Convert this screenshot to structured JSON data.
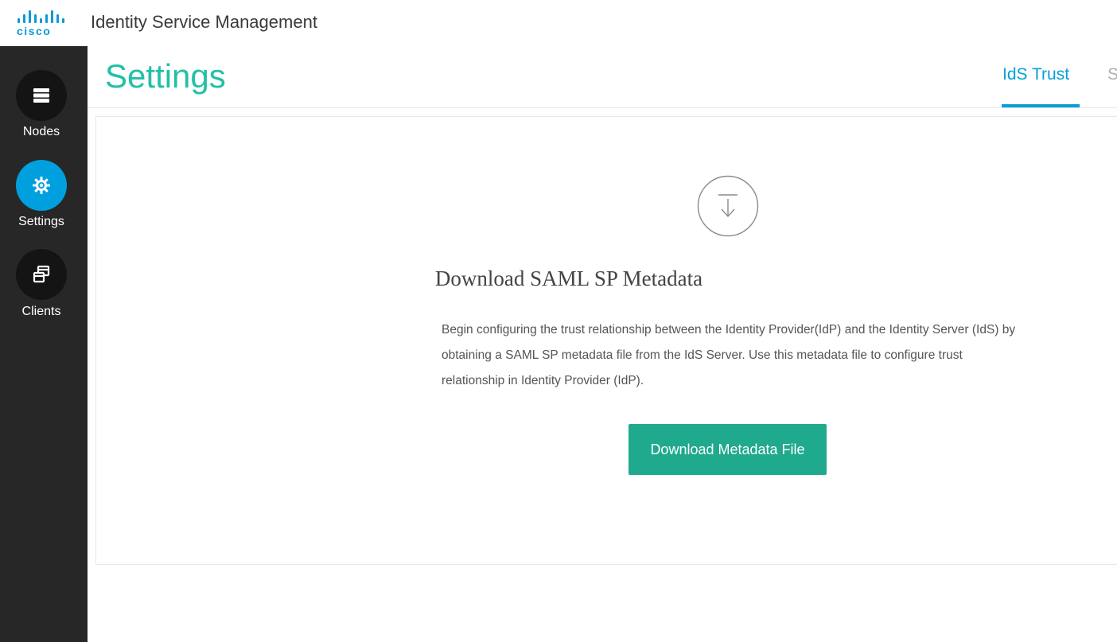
{
  "header": {
    "logo_text": "cisco",
    "app_title": "Identity Service Management",
    "brand_color": "#049fd9"
  },
  "sidebar": {
    "items": [
      {
        "label": "Nodes",
        "icon": "nodes-icon",
        "active": false
      },
      {
        "label": "Settings",
        "icon": "gear-icon",
        "active": true
      },
      {
        "label": "Clients",
        "icon": "clients-icon",
        "active": false
      }
    ]
  },
  "page": {
    "title": "Settings",
    "tabs": [
      {
        "label": "IdS Trust",
        "active": true
      },
      {
        "label": "S",
        "active": false
      }
    ]
  },
  "card": {
    "icon": "download-icon",
    "heading": "Download SAML SP Metadata",
    "description": "Begin configuring the trust relationship between the Identity Provider(IdP) and the Identity Server (IdS) by obtaining a SAML SP metadata file from the IdS Server. Use this metadata file to configure trust relationship in Identity Provider (IdP).",
    "button_label": "Download Metadata File",
    "button_color": "#1fa98d"
  }
}
